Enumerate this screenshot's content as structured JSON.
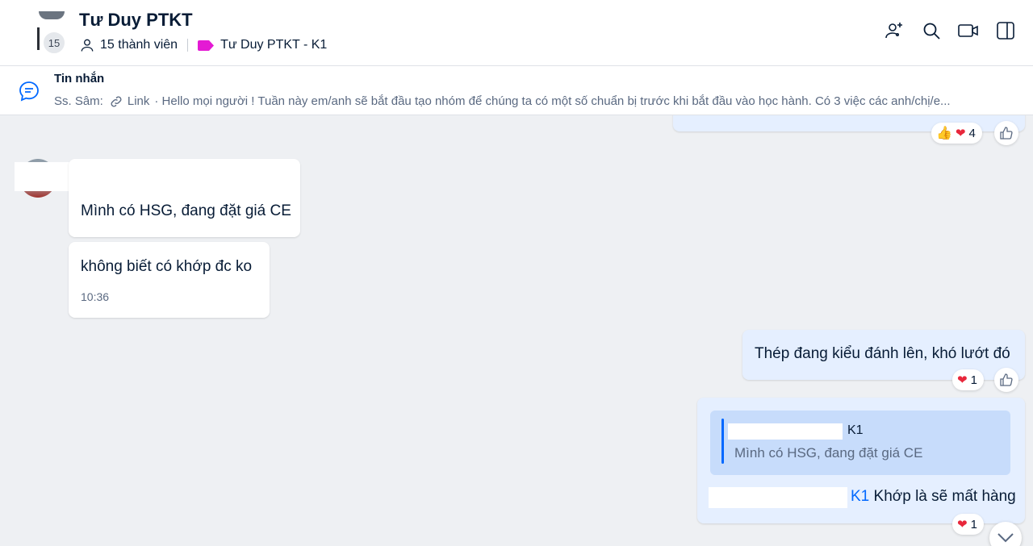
{
  "header": {
    "title": "Tư Duy PTKT",
    "member_count_badge": "15",
    "members_label": "15 thành viên",
    "tag_label": "Tư Duy PTKT - K1",
    "tag_color": "#e41ad4"
  },
  "pinned": {
    "title": "Tin nhắn",
    "sender": "Ss. Sâm:",
    "link_label": "Link",
    "preview": "· Hello mọi người ! Tuần này em/anh sẽ bắt đầu tạo nhóm để chúng ta có một số chuẩn bị trước khi bắt đầu vào học hành. Có 3 việc các anh/chị/e..."
  },
  "messages": {
    "top_reaction_count": "4",
    "m1_text": "Mình có HSG, đang đặt giá CE",
    "m2_text": "không biết có khớp đc ko",
    "m2_time": "10:36",
    "m3_text": "Thép đang kiểu đánh lên, khó lướt đó",
    "m3_reaction_count": "1",
    "m4_quote_name": "K1",
    "m4_quote_text": "Mình có HSG, đang đặt giá CE",
    "m4_mention": "K1",
    "m4_text": " Khớp là sẽ mất hàng",
    "m4_reaction_count": "1"
  },
  "colors": {
    "accent": "#0068ff",
    "outgoing_bubble": "#e5efff",
    "incoming_bubble": "#ffffff",
    "heart": "#e8273b"
  }
}
